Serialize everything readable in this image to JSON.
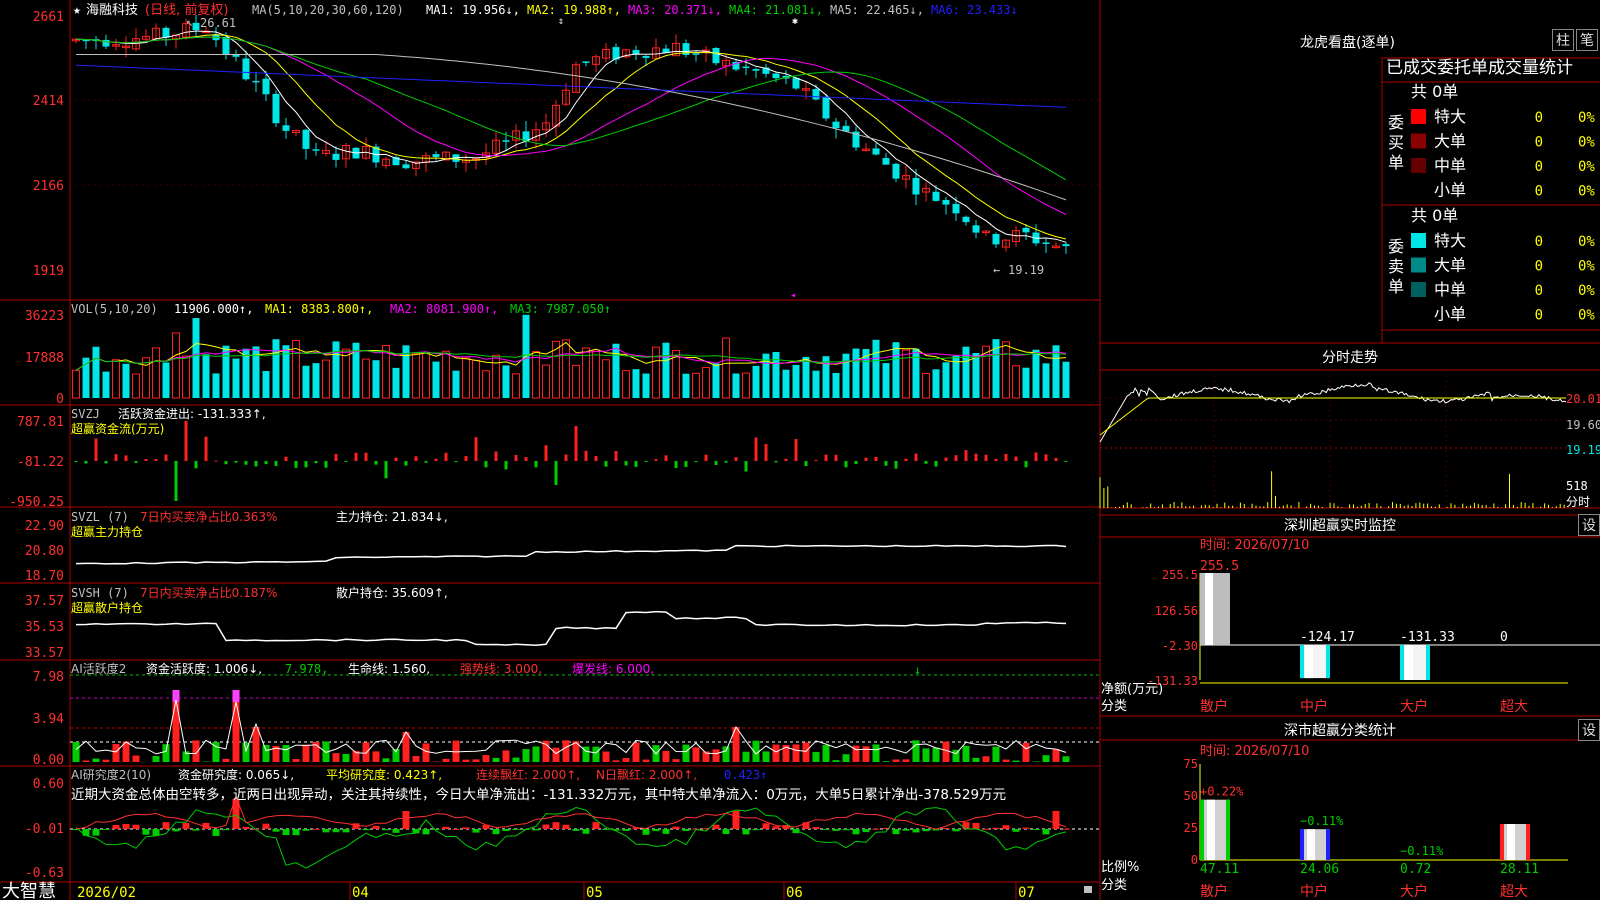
{
  "colors": {
    "up": "#ff2020",
    "down": "#00e5e5",
    "grid": "#b00000",
    "text": "#c0c0c0",
    "ma1": "#ffffff",
    "ma2": "#ffff00",
    "ma3": "#ff00ff",
    "ma4": "#00cc00",
    "ma5": "#c0c0c0",
    "ma6": "#2020ff"
  },
  "header": {
    "star": "★",
    "stock_name": "海融科技",
    "period": "(日线, 前复权)",
    "ma_def": "MA(5,10,20,30,60,120)",
    "ma1": "MA1: 19.956↓,",
    "ma2": "MA2: 19.988↑,",
    "ma3": "MA3: 20.371↓,",
    "ma4": "MA4: 21.081↓,",
    "ma5": "MA5: 22.465↓,",
    "ma6": "MA6: 23.433↓"
  },
  "price_axis": [
    "2661",
    "2414",
    "2166",
    "1919"
  ],
  "price_marks": {
    "high": "26.61",
    "low": "19.19"
  },
  "vol": {
    "label": "VOL(5,10,20)",
    "value": "11906.000↑,",
    "ma1": "MA1: 8383.800↑,",
    "ma2": "MA2: 8081.900↑,",
    "ma3": "MA3: 7987.050↑",
    "axis": [
      "36223",
      "17888",
      "0"
    ]
  },
  "svzj": {
    "label": "SVZJ",
    "desc": "活跃资金进出: -131.333↑,",
    "sub": "超赢资金流(万元)",
    "axis": [
      "787.81",
      "-81.22",
      "-950.25"
    ]
  },
  "svzl": {
    "label": "SVZL (7)",
    "desc": "7日内买卖净占比0.363%",
    "desc2": "主力持仓: 21.834↓,",
    "sub": "超赢主力持仓",
    "axis": [
      "22.90",
      "20.80",
      "18.70"
    ]
  },
  "svsh": {
    "label": "SVSH (7)",
    "desc": "7日内买卖净占比0.187%",
    "desc2": "散户持仓: 35.609↑,",
    "sub": "超赢散户持仓",
    "axis": [
      "37.57",
      "35.53",
      "33.57"
    ]
  },
  "ai2": {
    "label": "AI活跃度2",
    "a": "资金活跃度: 1.006↓,",
    "b": "7.978,",
    "c": "生命线: 1.560,",
    "d": "强势线: 3.000,",
    "e": "爆发线: 6.000,",
    "axis": [
      "7.98",
      "3.94",
      "0.00"
    ]
  },
  "ai3": {
    "label": "AI研究度2(10)",
    "a": "资金研究度: 0.065↓,",
    "b": "平均研究度: 0.423↑,",
    "c": "连续飘红: 2.000↑,",
    "d": "N日飘红: 2.000↑,",
    "e": "0.423↑",
    "note": "近期大资金总体由空转多，近两日出现异动，关注其持续性，今日大单净流出：-131.332万元，其中特大单净流入：0万元，大单5日累计净出-378.529万元",
    "axis": [
      "0.60",
      "-0.01",
      "-0.63"
    ]
  },
  "xaxis": [
    "2026/02",
    "04",
    "05",
    "06",
    "07"
  ],
  "brand": "大智慧",
  "right": {
    "title": "龙虎看盘(逐单)",
    "btn_bar": "柱",
    "btn_stroke": "笔",
    "table_title": "已成交委托单成交量统计",
    "buy": {
      "label": "委买单",
      "total": "共 0单",
      "rows": [
        {
          "name": "特大",
          "v": "0",
          "p": "0%"
        },
        {
          "name": "大单",
          "v": "0",
          "p": "0%"
        },
        {
          "name": "中单",
          "v": "0",
          "p": "0%"
        },
        {
          "name": "小单",
          "v": "0",
          "p": "0%"
        }
      ]
    },
    "sell": {
      "label": "委卖单",
      "total": "共 0单",
      "rows": [
        {
          "name": "特大",
          "v": "0",
          "p": "0%"
        },
        {
          "name": "大单",
          "v": "0",
          "p": "0%"
        },
        {
          "name": "中单",
          "v": "0",
          "p": "0%"
        },
        {
          "name": "小单",
          "v": "0",
          "p": "0%"
        }
      ]
    },
    "intraday": {
      "title": "分时走势",
      "axis": [
        "20.01",
        "19.60",
        "19.19"
      ],
      "vol_value": "518",
      "vol_label": "分时"
    },
    "monitor": {
      "title": "深圳超赢实时监控",
      "btn": "设",
      "time": "时间: 2026/07/10",
      "axis": [
        "255.5",
        "126.56",
        "-2.30",
        "-131.33"
      ],
      "ylabel": "净额(万元)",
      "xlabel": "分类",
      "values": [
        "255.5",
        "-124.17",
        "-131.33",
        "0"
      ],
      "bars": [
        255.5,
        -124.17,
        -131.33,
        0
      ],
      "cats": [
        "散户",
        "中户",
        "大户",
        "超大"
      ]
    },
    "classify": {
      "title": "深市超赢分类统计",
      "btn": "设",
      "time": "时间: 2026/07/10",
      "axis": [
        "75",
        "50",
        "25",
        "0"
      ],
      "ylabel": "比例%",
      "xlabel": "分类",
      "top": [
        "+0.22%",
        "−0.11%",
        "−0.11%",
        ""
      ],
      "bottom": [
        "47.11",
        "24.06",
        "0.72",
        "28.11"
      ],
      "bars": [
        47.11,
        24.06,
        0.72,
        28.11
      ],
      "cats": [
        "散户",
        "中户",
        "大户",
        "超大"
      ]
    }
  }
}
